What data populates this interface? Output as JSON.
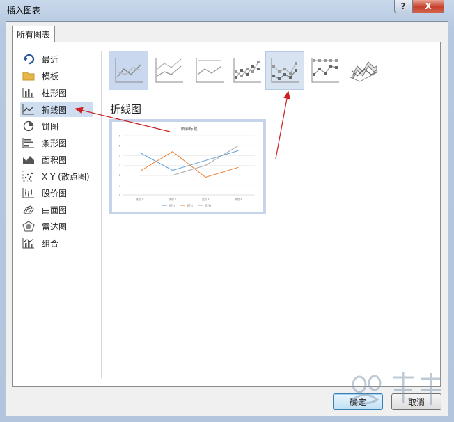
{
  "window": {
    "title": "插入图表",
    "help_glyph": "?",
    "close_glyph": "X"
  },
  "tabs": [
    {
      "label": "所有图表",
      "selected": true
    }
  ],
  "categories": [
    {
      "label": "最近",
      "icon": "recent-icon"
    },
    {
      "label": "模板",
      "icon": "folder-icon"
    },
    {
      "label": "柱形图",
      "icon": "column-chart-icon"
    },
    {
      "label": "折线图",
      "icon": "line-chart-icon",
      "selected": true
    },
    {
      "label": "饼图",
      "icon": "pie-chart-icon"
    },
    {
      "label": "条形图",
      "icon": "bar-chart-icon"
    },
    {
      "label": "面积图",
      "icon": "area-chart-icon"
    },
    {
      "label": "X Y (散点图)",
      "icon": "scatter-chart-icon"
    },
    {
      "label": "股价图",
      "icon": "stock-chart-icon"
    },
    {
      "label": "曲面图",
      "icon": "surface-chart-icon"
    },
    {
      "label": "雷达图",
      "icon": "radar-chart-icon"
    },
    {
      "label": "组合",
      "icon": "combo-chart-icon"
    }
  ],
  "subtypes": [
    {
      "icon": "line-icon",
      "selected": true
    },
    {
      "icon": "stacked-line-icon"
    },
    {
      "icon": "100-stacked-line-icon"
    },
    {
      "icon": "line-with-markers-icon"
    },
    {
      "icon": "stacked-line-with-markers-icon",
      "highlighted": true
    },
    {
      "icon": "100-stacked-line-with-markers-icon"
    },
    {
      "icon": "3d-line-icon"
    }
  ],
  "selected_type_title": "折线图",
  "preview": {
    "chart_data": {
      "type": "line",
      "title": "图表标题",
      "categories": [
        "类别 1",
        "类别 2",
        "类别 3",
        "类别 4"
      ],
      "ylim": [
        0,
        6
      ],
      "yticks": [
        "0",
        "1",
        "2",
        "3",
        "4",
        "5",
        "6"
      ],
      "series": [
        {
          "name": "系列1",
          "values": [
            4.3,
            2.5,
            3.5,
            4.5
          ],
          "color": "#5b9bd5"
        },
        {
          "name": "系列2",
          "values": [
            2.4,
            4.4,
            1.8,
            2.8
          ],
          "color": "#ed7d31"
        },
        {
          "name": "系列3",
          "values": [
            2.0,
            2.0,
            3.0,
            5.0
          ],
          "color": "#a5a5a5"
        }
      ]
    }
  },
  "buttons": {
    "ok": "确定",
    "cancel": "取消"
  },
  "colors": {
    "annotation_arrow": "#cc1f1f",
    "selection": "#cfddf0"
  }
}
